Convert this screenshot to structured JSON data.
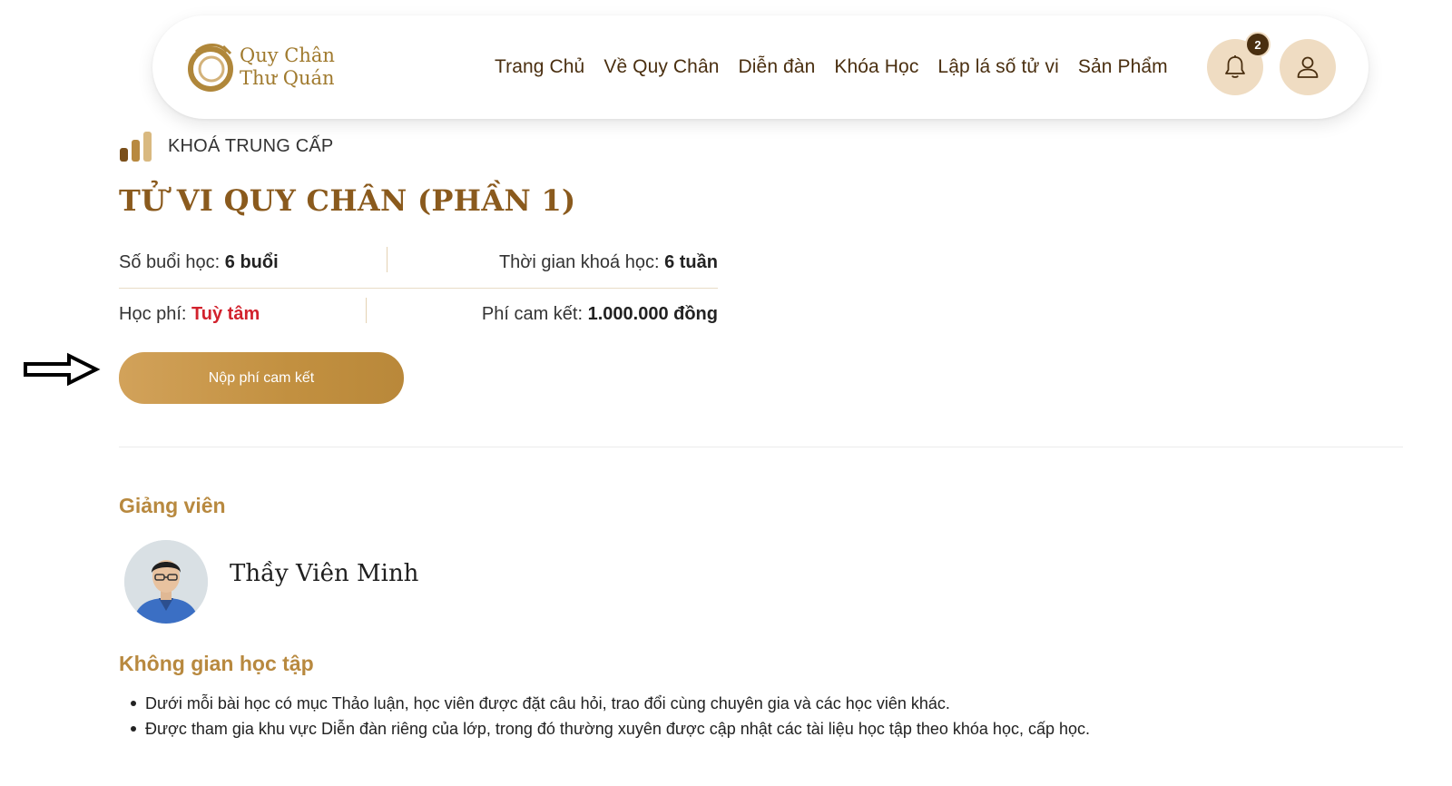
{
  "header": {
    "logo": {
      "line1": "Quy Chân",
      "line2": "Thư Quán"
    },
    "nav": [
      {
        "label": "Trang Chủ"
      },
      {
        "label": "Về Quy Chân"
      },
      {
        "label": "Diễn đàn"
      },
      {
        "label": "Khóa Học"
      },
      {
        "label": "Lập lá số tử vi"
      },
      {
        "label": "Sản Phẩm"
      }
    ],
    "notifications": {
      "count": "2",
      "icon": "bell-icon"
    },
    "account": {
      "icon": "user-icon"
    }
  },
  "course": {
    "level": "KHOÁ TRUNG CẤP",
    "title": "TỬ VI QUY CHÂN (PHẦN 1)",
    "sessions_label": "Số buổi học:",
    "sessions_value": "6 buổi",
    "duration_label": "Thời gian khoá học:",
    "duration_value": "6 tuần",
    "fee_label": "Học phí:",
    "fee_value": "Tuỳ tâm",
    "commit_label": "Phí cam kết:",
    "commit_value": "1.000.000 đồng",
    "cta_label": "Nộp phí cam kết"
  },
  "instructor": {
    "section_title": "Giảng viên",
    "name": "Thầy Viên Minh"
  },
  "learning_space": {
    "section_title": "Không gian học tập",
    "items": [
      "Dưới mỗi bài học có mục Thảo luận, học viên được đặt câu hỏi, trao đổi cùng chuyên gia và các học viên khác.",
      "Được tham gia khu vực Diễn đàn riêng của lớp, trong đó thường xuyên được cập nhật các tài liệu học tập theo khóa học, cấp học."
    ]
  },
  "colors": {
    "brand_gold": "#b8893f",
    "brand_brown": "#4a2f10",
    "fee_red": "#d2222d",
    "icon_bg": "#efdcc2"
  }
}
